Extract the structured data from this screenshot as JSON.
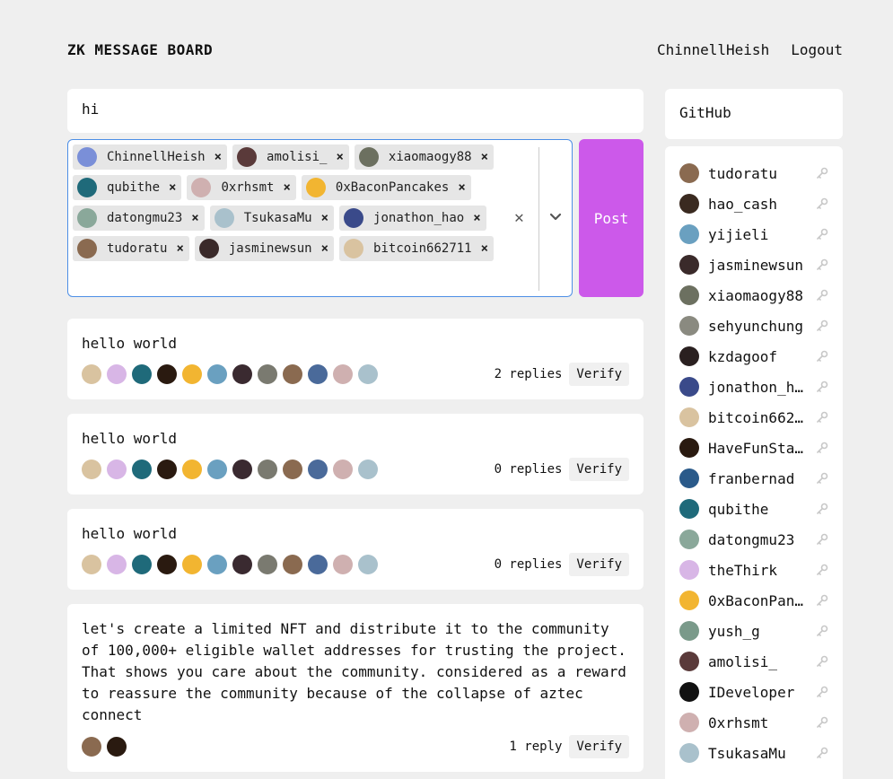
{
  "header": {
    "title": "ZK MESSAGE BOARD",
    "user": "ChinnellHeish",
    "logout": "Logout"
  },
  "composer": {
    "text": "hi"
  },
  "selected_users": [
    {
      "name": "ChinnellHeish",
      "color": "#7a8fd8"
    },
    {
      "name": "amolisi_",
      "color": "#5a3a3a"
    },
    {
      "name": "xiaomaogy88",
      "color": "#6c7060"
    },
    {
      "name": "qubithe",
      "color": "#1f6a7a"
    },
    {
      "name": "0xrhsmt",
      "color": "#cfb0b0"
    },
    {
      "name": "0xBaconPancakes",
      "color": "#f2b531"
    },
    {
      "name": "datongmu23",
      "color": "#8aa89a"
    },
    {
      "name": "TsukasaMu",
      "color": "#a9c1cc"
    },
    {
      "name": "jonathon_hao",
      "color": "#3a4a8a"
    },
    {
      "name": "tudoratu",
      "color": "#8a6a50"
    },
    {
      "name": "jasminewsun",
      "color": "#3a2a2a"
    },
    {
      "name": "bitcoin662711",
      "color": "#d9c3a0"
    }
  ],
  "post_label": "Post",
  "verify_label": "Verify",
  "messages": [
    {
      "text": "hello world",
      "replies": "2 replies",
      "avatars": [
        "#d9c3a0",
        "#d8b6e6",
        "#1f6a7a",
        "#2a1a10",
        "#f2b531",
        "#6aa0c0",
        "#3a2a30",
        "#7a7a70",
        "#8a6a50",
        "#4a6a9a",
        "#cfb0b0",
        "#a9c1cc"
      ]
    },
    {
      "text": "hello world",
      "replies": "0 replies",
      "avatars": [
        "#d9c3a0",
        "#d8b6e6",
        "#1f6a7a",
        "#2a1a10",
        "#f2b531",
        "#6aa0c0",
        "#3a2a30",
        "#7a7a70",
        "#8a6a50",
        "#4a6a9a",
        "#cfb0b0",
        "#a9c1cc"
      ]
    },
    {
      "text": "hello world",
      "replies": "0 replies",
      "avatars": [
        "#d9c3a0",
        "#d8b6e6",
        "#1f6a7a",
        "#2a1a10",
        "#f2b531",
        "#6aa0c0",
        "#3a2a30",
        "#7a7a70",
        "#8a6a50",
        "#4a6a9a",
        "#cfb0b0",
        "#a9c1cc"
      ]
    },
    {
      "text": "let's create a limited NFT and distribute it to the community of 100,000+ eligible wallet addresses for trusting the project. That shows you care about the community. considered as a reward to reassure the community because of the collapse of aztec connect",
      "replies": "1 reply",
      "avatars": [
        "#8a6a50",
        "#2a1a10"
      ]
    }
  ],
  "github_label": "GitHub",
  "users": [
    {
      "name": "tudoratu",
      "color": "#8a6a50"
    },
    {
      "name": "hao_cash",
      "color": "#3a2a20"
    },
    {
      "name": "yijieli",
      "color": "#6aa0c0"
    },
    {
      "name": "jasminewsun",
      "color": "#3a2a2a"
    },
    {
      "name": "xiaomaogy88",
      "color": "#6c7060"
    },
    {
      "name": "sehyunchung",
      "color": "#8a8a80"
    },
    {
      "name": "kzdagoof",
      "color": "#2a2020"
    },
    {
      "name": "jonathon_h…",
      "color": "#3a4a8a"
    },
    {
      "name": "bitcoin662…",
      "color": "#d9c3a0"
    },
    {
      "name": "HaveFunSta…",
      "color": "#2a1a10"
    },
    {
      "name": "franbernad",
      "color": "#2a5a8a"
    },
    {
      "name": "qubithe",
      "color": "#1f6a7a"
    },
    {
      "name": "datongmu23",
      "color": "#8aa89a"
    },
    {
      "name": "theThirk",
      "color": "#d8b6e6"
    },
    {
      "name": "0xBaconPan…",
      "color": "#f2b531"
    },
    {
      "name": "yush_g",
      "color": "#7a9a8a"
    },
    {
      "name": "amolisi_",
      "color": "#5a3a3a"
    },
    {
      "name": "IDeveloper",
      "color": "#111111"
    },
    {
      "name": "0xrhsmt",
      "color": "#cfb0b0"
    },
    {
      "name": "TsukasaMu",
      "color": "#a9c1cc"
    }
  ]
}
